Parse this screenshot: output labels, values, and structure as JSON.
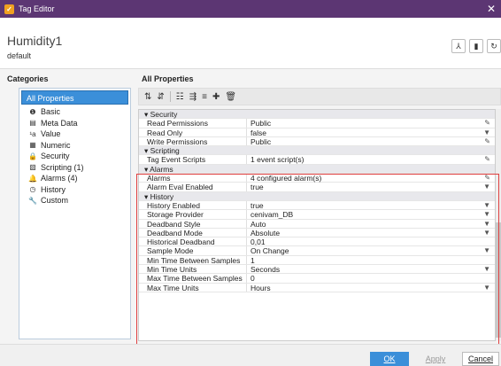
{
  "window": {
    "title": "Tag Editor",
    "close_glyph": "✕"
  },
  "header": {
    "tag_name": "Humidity1",
    "provider": "default"
  },
  "categories": {
    "title": "Categories",
    "selected": "All Properties",
    "items": [
      {
        "icon": "info-icon",
        "glyph": "❶",
        "label": "Basic"
      },
      {
        "icon": "metadata-icon",
        "glyph": "▤",
        "label": "Meta Data"
      },
      {
        "icon": "value-icon",
        "glyph": "¹a",
        "label": "Value"
      },
      {
        "icon": "numeric-icon",
        "glyph": "▦",
        "label": "Numeric"
      },
      {
        "icon": "lock-icon",
        "glyph": "🔒",
        "label": "Security"
      },
      {
        "icon": "script-icon",
        "glyph": "▧",
        "label": "Scripting (1)"
      },
      {
        "icon": "bell-icon",
        "glyph": "🔔",
        "label": "Alarms (4)"
      },
      {
        "icon": "clock-icon",
        "glyph": "◷",
        "label": "History"
      },
      {
        "icon": "wrench-icon",
        "glyph": "🔧",
        "label": "Custom"
      }
    ]
  },
  "properties": {
    "title": "All Properties",
    "rows": [
      {
        "type": "section",
        "label": "Security"
      },
      {
        "type": "prop",
        "key": "Read Permissions",
        "value": "Public",
        "action": "✎"
      },
      {
        "type": "prop",
        "key": "Read Only",
        "value": "false",
        "action": "▼"
      },
      {
        "type": "prop",
        "key": "Write Permissions",
        "value": "Public",
        "action": "✎"
      },
      {
        "type": "section",
        "label": "Scripting"
      },
      {
        "type": "prop",
        "key": "Tag Event Scripts",
        "value": "1 event script(s)",
        "action": "✎"
      },
      {
        "type": "section",
        "label": "Alarms"
      },
      {
        "type": "prop",
        "key": "Alarms",
        "value": "4 configured alarm(s)",
        "action": "✎"
      },
      {
        "type": "prop",
        "key": "Alarm Eval Enabled",
        "value": "true",
        "action": "▼"
      },
      {
        "type": "section",
        "label": "History"
      },
      {
        "type": "prop",
        "key": "History Enabled",
        "value": "true",
        "action": "▼"
      },
      {
        "type": "prop",
        "key": "Storage Provider",
        "value": "cenivam_DB",
        "action": "▼"
      },
      {
        "type": "prop",
        "key": "Deadband Style",
        "value": "Auto",
        "action": "▼"
      },
      {
        "type": "prop",
        "key": "Deadband Mode",
        "value": "Absolute",
        "action": "▼"
      },
      {
        "type": "prop",
        "key": "Historical Deadband",
        "value": "0,01",
        "action": ""
      },
      {
        "type": "prop",
        "key": "Sample Mode",
        "value": "On Change",
        "action": "▼"
      },
      {
        "type": "prop",
        "key": "Min Time Between Samples",
        "value": "1",
        "action": ""
      },
      {
        "type": "prop",
        "key": "Min Time Units",
        "value": "Seconds",
        "action": "▼"
      },
      {
        "type": "prop",
        "key": "Max Time Between Samples",
        "value": "0",
        "action": ""
      },
      {
        "type": "prop",
        "key": "Max Time Units",
        "value": "Hours",
        "action": "▼"
      }
    ]
  },
  "footer": {
    "ok": "OK",
    "apply": "Apply",
    "cancel": "Cancel"
  }
}
